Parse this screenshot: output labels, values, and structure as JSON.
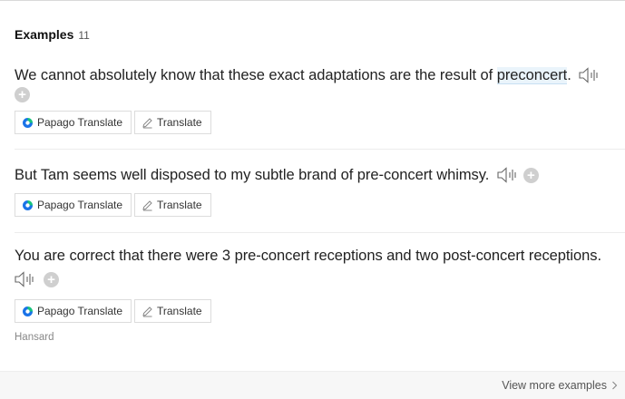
{
  "header": {
    "title": "Examples",
    "count": "11"
  },
  "examples": [
    {
      "text_before": "We cannot absolutely know that these exact adaptations are the result of ",
      "highlight": "preconcert",
      "text_after": ".",
      "buttons": {
        "papago": "Papago Translate",
        "translate": "Translate"
      }
    },
    {
      "text": "But Tam seems well disposed to my subtle brand of pre-concert whimsy.",
      "buttons": {
        "papago": "Papago Translate",
        "translate": "Translate"
      }
    },
    {
      "text": "You are correct that there were 3 pre-concert receptions and two post-concert receptions.",
      "buttons": {
        "papago": "Papago Translate",
        "translate": "Translate"
      },
      "source": "Hansard"
    }
  ],
  "footer": {
    "view_more": "View more examples"
  },
  "icons": {
    "speaker": "speaker-icon",
    "add": "plus-icon",
    "papago": "papago-logo-icon",
    "translate": "pencil-icon",
    "chevron": "chevron-right-icon"
  },
  "colors": {
    "highlight_bg": "#eaf4fb",
    "papago_green": "#19c37d",
    "papago_blue": "#1a73e8"
  }
}
